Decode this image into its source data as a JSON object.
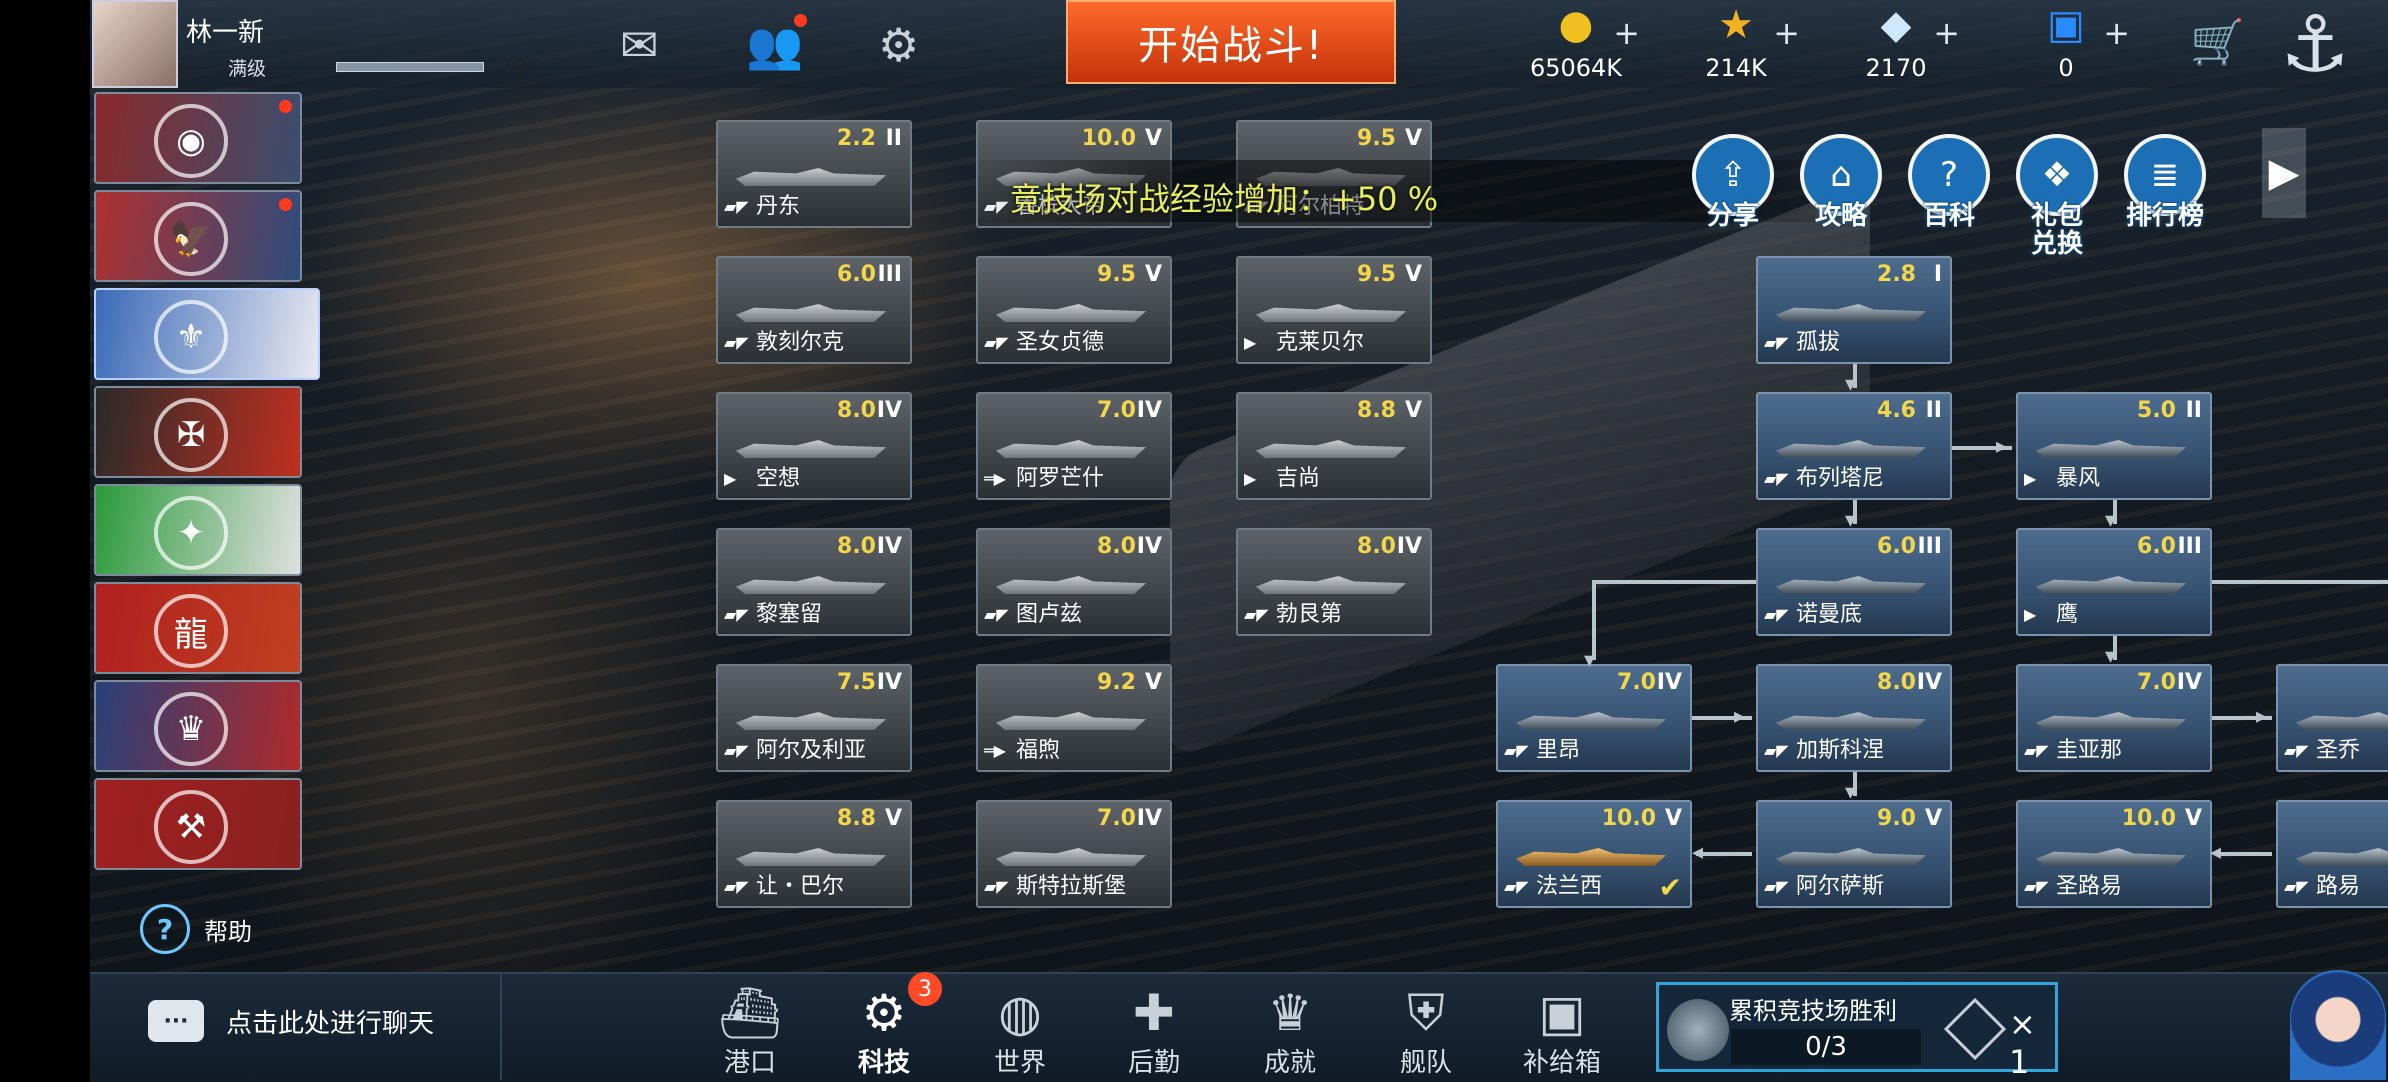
{
  "player": {
    "name": "林一新",
    "level_label": "满级"
  },
  "top": {
    "battle_button": "开始战斗!",
    "resources": [
      {
        "icon": "gold-coin-icon",
        "value": "65064K"
      },
      {
        "icon": "star-icon",
        "value": "214K"
      },
      {
        "icon": "diamond-icon",
        "value": "2170"
      },
      {
        "icon": "cube-icon",
        "value": "0"
      }
    ]
  },
  "nations": [
    {
      "name": "nation-usa-1",
      "badge": true,
      "colors": [
        "#8a2a2a",
        "#3a4e70"
      ],
      "symbol": "◉"
    },
    {
      "name": "nation-usa",
      "badge": true,
      "colors": [
        "#b03030",
        "#2d4c7c"
      ],
      "symbol": "🦅"
    },
    {
      "name": "nation-france",
      "badge": false,
      "colors": [
        "#3a6ab8",
        "#e8e8f0"
      ],
      "symbol": "⚜"
    },
    {
      "name": "nation-germany",
      "badge": false,
      "colors": [
        "#2a2a2a",
        "#c03020"
      ],
      "symbol": "✠"
    },
    {
      "name": "nation-italy",
      "badge": false,
      "colors": [
        "#2a9a3a",
        "#e0e0e0"
      ],
      "symbol": "✦"
    },
    {
      "name": "nation-china",
      "badge": false,
      "colors": [
        "#b02020",
        "#c04020"
      ],
      "symbol": "龍"
    },
    {
      "name": "nation-uk",
      "badge": false,
      "colors": [
        "#28407a",
        "#b02a2a"
      ],
      "symbol": "♛"
    },
    {
      "name": "nation-ussr",
      "badge": false,
      "colors": [
        "#a02020",
        "#8a2020"
      ],
      "symbol": "⚒"
    }
  ],
  "help_label": "帮助",
  "notice": "竞技场对战经验增加：+50 %",
  "quick_buttons": [
    {
      "label": "分享",
      "icon": "share-icon",
      "glyph": "⇪"
    },
    {
      "label": "攻略",
      "icon": "home-guide-icon",
      "glyph": "⌂"
    },
    {
      "label": "百科",
      "icon": "question-icon",
      "glyph": "?"
    },
    {
      "label": "礼包兑换",
      "icon": "gift-icon",
      "glyph": "❖"
    },
    {
      "label": "排行榜",
      "icon": "ranking-icon",
      "glyph": "≣"
    }
  ],
  "ships_grid": [
    {
      "name": "丹东",
      "level": "2.2",
      "tier": "II",
      "cls": "▰◤"
    },
    {
      "name": "香槟大帝",
      "level": "10.0",
      "tier": "V",
      "cls": "▰◤"
    },
    {
      "name": "阿尔柏特",
      "level": "9.5",
      "tier": "V",
      "cls": "▰◤"
    },
    {
      "name": "敦刻尔克",
      "level": "6.0",
      "tier": "III",
      "cls": "▰◤"
    },
    {
      "name": "圣女贞德",
      "level": "9.5",
      "tier": "V",
      "cls": "▰◤"
    },
    {
      "name": "克莱贝尔",
      "level": "9.5",
      "tier": "V",
      "cls": "▶"
    },
    {
      "name": "空想",
      "level": "8.0",
      "tier": "IV",
      "cls": "▶"
    },
    {
      "name": "阿罗芒什",
      "level": "7.0",
      "tier": "IV",
      "cls": "═▶"
    },
    {
      "name": "吉尚",
      "level": "8.8",
      "tier": "V",
      "cls": "▶"
    },
    {
      "name": "黎塞留",
      "level": "8.0",
      "tier": "IV",
      "cls": "▰◤"
    },
    {
      "name": "图卢兹",
      "level": "8.0",
      "tier": "IV",
      "cls": "▰◤"
    },
    {
      "name": "勃艮第",
      "level": "8.0",
      "tier": "IV",
      "cls": "▰◤"
    },
    {
      "name": "阿尔及利亚",
      "level": "7.5",
      "tier": "IV",
      "cls": "▰◤"
    },
    {
      "name": "福煦",
      "level": "9.2",
      "tier": "V",
      "cls": "═▶"
    },
    {
      "name": "让・巴尔",
      "level": "8.8",
      "tier": "V",
      "cls": "▰◤"
    },
    {
      "name": "斯特拉斯堡",
      "level": "7.0",
      "tier": "IV",
      "cls": "▰◤"
    }
  ],
  "tree": [
    {
      "name": "孤拔",
      "level": "2.8",
      "tier": "I",
      "cls": "▰◤"
    },
    {
      "name": "布列塔尼",
      "level": "4.6",
      "tier": "II",
      "cls": "▰◤"
    },
    {
      "name": "暴风",
      "level": "5.0",
      "tier": "II",
      "cls": "▶"
    },
    {
      "name": "诺曼底",
      "level": "6.0",
      "tier": "III",
      "cls": "▰◤"
    },
    {
      "name": "鹰",
      "level": "6.0",
      "tier": "III",
      "cls": "▶"
    },
    {
      "name": "里昂",
      "level": "7.0",
      "tier": "IV",
      "cls": "▰◤"
    },
    {
      "name": "加斯科涅",
      "level": "8.0",
      "tier": "IV",
      "cls": "▰◤"
    },
    {
      "name": "圭亚那",
      "level": "7.0",
      "tier": "IV",
      "cls": "▰◤"
    },
    {
      "name": "圣乔",
      "level": "",
      "tier": "",
      "cls": "▰◤"
    },
    {
      "name": "法兰西",
      "level": "10.0",
      "tier": "V",
      "cls": "▰◤",
      "owned": true
    },
    {
      "name": "阿尔萨斯",
      "level": "9.0",
      "tier": "V",
      "cls": "▰◤"
    },
    {
      "name": "圣路易",
      "level": "10.0",
      "tier": "V",
      "cls": "▰◤"
    },
    {
      "name": "路易",
      "level": "",
      "tier": "",
      "cls": "▰◤"
    }
  ],
  "chat_placeholder": "点击此处进行聊天",
  "nav": [
    {
      "label": "港口",
      "icon": "port-icon",
      "glyph": "⛴"
    },
    {
      "label": "科技",
      "icon": "tech-icon",
      "glyph": "⚙",
      "active": true,
      "badge": "3"
    },
    {
      "label": "世界",
      "icon": "globe-icon",
      "glyph": "◍"
    },
    {
      "label": "后勤",
      "icon": "logistics-icon",
      "glyph": "✚"
    },
    {
      "label": "成就",
      "icon": "achievement-icon",
      "glyph": "♛"
    },
    {
      "label": "舰队",
      "icon": "fleet-icon",
      "glyph": "⛨"
    },
    {
      "label": "补给箱",
      "icon": "supply-box-icon",
      "glyph": "▣"
    }
  ],
  "quest": {
    "title": "累积竞技场胜利",
    "progress": "0/3",
    "reward_count": "× 1"
  }
}
